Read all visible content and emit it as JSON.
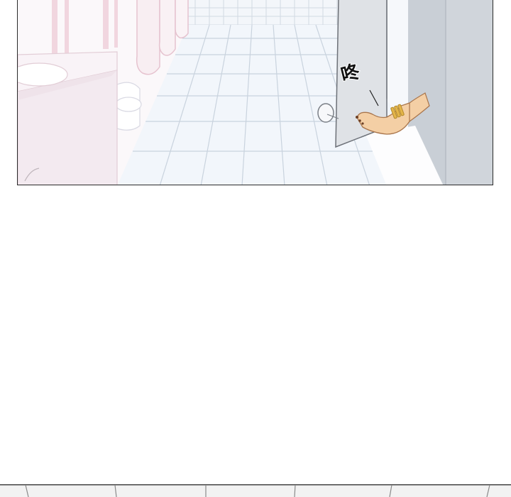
{
  "panel_1": {
    "sound_effect": "咚"
  },
  "colors": {
    "floor_tile": "#f2f6fb",
    "tile_grout": "#c9d3de",
    "stall_door": "#dde1e6",
    "stall_wall": "#c8ced5",
    "sink_counter": "#f6f0f4",
    "wall_stripe": "#f1d6df",
    "skin": "#f4cfa5",
    "anklet": "#e4b54a",
    "panel_border": "#2a2a2a"
  }
}
